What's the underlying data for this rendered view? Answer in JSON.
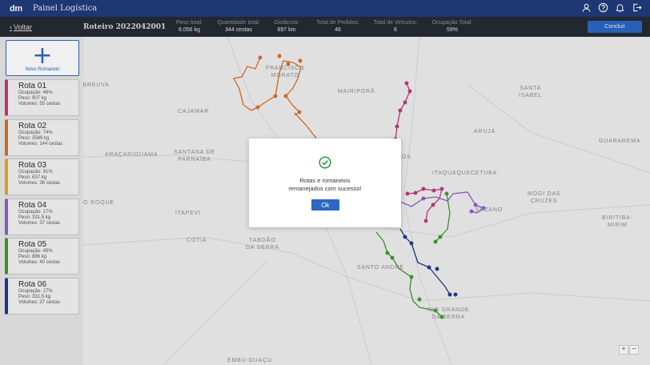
{
  "header": {
    "logo": "dm",
    "title": "Painel Logística"
  },
  "summary": {
    "back_label": "Voltar",
    "roteiro": "Roteiro 2022042001",
    "stats": [
      {
        "label": "Peso total:",
        "value": "6.056 kg"
      },
      {
        "label": "Quantidade total:",
        "value": "344 cestas"
      },
      {
        "label": "Distância:",
        "value": "697 km"
      },
      {
        "label": "Total de Pedidos:",
        "value": "46"
      },
      {
        "label": "Total de Veículos:",
        "value": "6"
      },
      {
        "label": "Ocupação Total:",
        "value": "59%"
      }
    ],
    "conclude_label": "Concluir"
  },
  "sidebar": {
    "new_label": "Novo Romaneio",
    "routes": [
      {
        "name": "Rota 01",
        "occupation": "Ocupação: 46%",
        "weight": "Peso: 907 kg",
        "volume": "Volumes: 55 cestas",
        "color": "#c0397a"
      },
      {
        "name": "Rota 02",
        "occupation": "Ocupação: 74%",
        "weight": "Peso: 3589 kg",
        "volume": "Volumes: 144 cestas",
        "color": "#d86f28"
      },
      {
        "name": "Rota 03",
        "occupation": "Ocupação: 91%",
        "weight": "Peso: 637 kg",
        "volume": "Volumes: 36 cestas",
        "color": "#e2a81f"
      },
      {
        "name": "Rota 04",
        "occupation": "Ocupação: 17%",
        "weight": "Peso: 331,5 kg",
        "volume": "Volumes: 37 cestas",
        "color": "#8e5fc9"
      },
      {
        "name": "Rota 05",
        "occupation": "Ocupação: 45%",
        "weight": "Peso: 886 kg",
        "volume": "Volumes: 40 cestas",
        "color": "#3e9a32"
      },
      {
        "name": "Rota 06",
        "occupation": "Ocupação: 17%",
        "weight": "Peso: 331,5 kg",
        "volume": "Volumes: 37 cestas",
        "color": "#233a8f"
      }
    ]
  },
  "map": {
    "places": {
      "abreuva": "ABREUVA",
      "franco_morato": "FRANCISCO\nMORATO",
      "mairipora": "MAIRIPORÃ",
      "santa_isabel": "SANTA\nISABEL",
      "cajamar": "CAJAMAR",
      "aruja": "ARUJÁ",
      "guarerema": "GUARAREMA",
      "aracariguama": "ARAÇARIGUAMA",
      "santana": "SANTANA DE\nPARNAÍBA",
      "itaquaquecetuba": "ITAQUAQUECETUBA",
      "mogi": "MOGI DAS\nCRUZES",
      "roque": "O ROQUE",
      "itapevi": "ITAPEVI",
      "suzano": "SUZANO",
      "biritiba": "BIRITIBA-\nMIRIM",
      "cotia": "COTIA",
      "taboao": "TABOÃO\nDA SERRA",
      "santo_andre": "SANTO ANDRÉ",
      "rio_grande": "RIO GRANDE\nDA SERRA",
      "embu": "EMBU-GUAÇU",
      "guarulhos_fragment": "OS"
    },
    "zoom_in": "+",
    "zoom_out": "−"
  },
  "modal": {
    "message_line1": "Rotas e romaneios",
    "message_line2": "remanejados com sucesso!",
    "ok_label": "Ok"
  }
}
